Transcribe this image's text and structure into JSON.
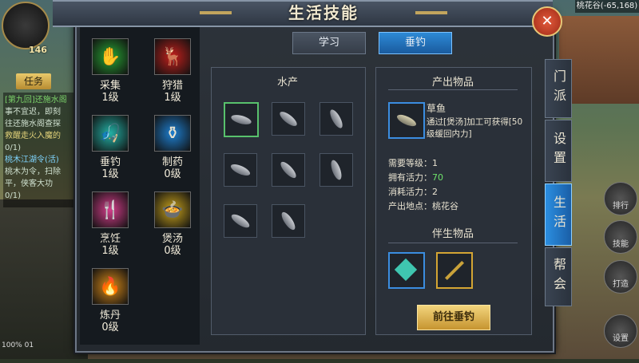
{
  "window": {
    "title": "生活技能",
    "close_glyph": "✕"
  },
  "hud": {
    "level": "146",
    "quest_tab": "任务",
    "quest_lines": [
      {
        "text": "[第九回]还施水阁",
        "tone": "q1"
      },
      {
        "text": "事不宜迟，即刻",
        "tone": ""
      },
      {
        "text": "往还施水阁查探",
        "tone": ""
      },
      {
        "text": "救醒走火入魔的",
        "tone": "q2"
      },
      {
        "text": "0/1)",
        "tone": ""
      },
      {
        "text": "桃木江湖令(活)",
        "tone": "q3"
      },
      {
        "text": "桃木为令，扫除",
        "tone": ""
      },
      {
        "text": "平，侠客大功",
        "tone": ""
      },
      {
        "text": "0/1)",
        "tone": ""
      }
    ],
    "status": "100%  01",
    "location": "桃花谷(-65,168)",
    "side_buttons": [
      {
        "label": "排行"
      },
      {
        "label": "技能"
      },
      {
        "label": "打造"
      },
      {
        "label": "设置"
      }
    ]
  },
  "skills": [
    {
      "name": "采集",
      "level": "1级",
      "icon": "hand-icon",
      "color": "#27a634"
    },
    {
      "name": "狩猎",
      "level": "1级",
      "icon": "deer-icon",
      "color": "#c4201c"
    },
    {
      "name": "垂钓",
      "level": "1级",
      "icon": "fishing-icon",
      "color": "#23b1a6"
    },
    {
      "name": "制药",
      "level": "0级",
      "icon": "gourd-icon",
      "color": "#1e7fd0"
    },
    {
      "name": "烹饪",
      "level": "1级",
      "icon": "cooking-icon",
      "color": "#d63e8c"
    },
    {
      "name": "煲汤",
      "level": "0级",
      "icon": "pot-icon",
      "color": "#c8a21c"
    },
    {
      "name": "炼丹",
      "level": "0级",
      "icon": "alchemy-icon",
      "color": "#d98a18"
    }
  ],
  "tabs": {
    "study": "学习",
    "fishing": "垂钓"
  },
  "aquatic": {
    "title": "水产",
    "slots": 8
  },
  "output": {
    "title": "产出物品",
    "item_name": "草鱼",
    "item_desc": "通过[煲汤]加工可获得[50级缓回内力]",
    "stats": [
      {
        "label": "需要等级：",
        "value": "1",
        "tone": "v"
      },
      {
        "label": "拥有活力：",
        "value": "70",
        "tone": "vg"
      },
      {
        "label": "消耗活力：",
        "value": "2",
        "tone": "v"
      },
      {
        "label": "产出地点：",
        "value": "桃花谷",
        "tone": "v"
      }
    ],
    "byproduct_title": "伴生物品",
    "go_button": "前往垂钓"
  },
  "side_tabs": [
    {
      "label": "门派"
    },
    {
      "label": "设置"
    },
    {
      "label": "生活",
      "active": true
    },
    {
      "label": "帮会"
    }
  ],
  "colors": {
    "accent": "#2d8ad6",
    "selected_slot": "#58c16c",
    "gold": "#d4a533"
  }
}
